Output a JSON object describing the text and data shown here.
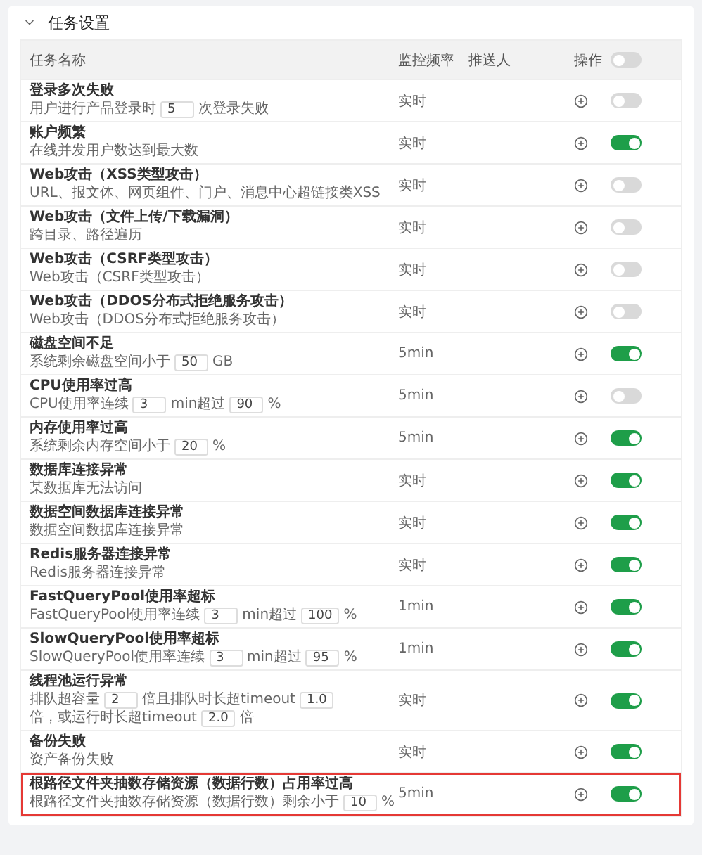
{
  "section": {
    "title": "任务设置",
    "expanded": true
  },
  "table": {
    "columns": [
      "任务名称",
      "监控频率",
      "推送人",
      "操作"
    ],
    "master_toggle": {
      "on": false
    },
    "rows": [
      {
        "name": "登录多次失败",
        "desc": [
          {
            "kind": "text",
            "text": "用户进行产品登录时"
          },
          {
            "kind": "input",
            "value": "5"
          },
          {
            "kind": "text",
            "text": "次登录失败"
          }
        ],
        "frequency": "实时",
        "on": false,
        "highlighted": false
      },
      {
        "name": "账户频繁",
        "desc": [
          {
            "kind": "text",
            "text": "在线并发用户数达到最大数"
          }
        ],
        "frequency": "实时",
        "on": true,
        "highlighted": false
      },
      {
        "name": "Web攻击（XSS类型攻击）",
        "desc": [
          {
            "kind": "text",
            "text": "URL、报文体、网页组件、门户、消息中心超链接类XSS"
          }
        ],
        "frequency": "实时",
        "on": false,
        "highlighted": false
      },
      {
        "name": "Web攻击（文件上传/下载漏洞）",
        "desc": [
          {
            "kind": "text",
            "text": "跨目录、路径遍历"
          }
        ],
        "frequency": "实时",
        "on": false,
        "highlighted": false
      },
      {
        "name": "Web攻击（CSRF类型攻击）",
        "desc": [
          {
            "kind": "text",
            "text": "Web攻击（CSRF类型攻击）"
          }
        ],
        "frequency": "实时",
        "on": false,
        "highlighted": false
      },
      {
        "name": "Web攻击（DDOS分布式拒绝服务攻击）",
        "desc": [
          {
            "kind": "text",
            "text": "Web攻击（DDOS分布式拒绝服务攻击）"
          }
        ],
        "frequency": "实时",
        "on": false,
        "highlighted": false
      },
      {
        "name": "磁盘空间不足",
        "desc": [
          {
            "kind": "text",
            "text": "系统剩余磁盘空间小于"
          },
          {
            "kind": "input",
            "value": "50"
          },
          {
            "kind": "text",
            "text": "GB"
          }
        ],
        "frequency": "5min",
        "on": true,
        "highlighted": false
      },
      {
        "name": "CPU使用率过高",
        "desc": [
          {
            "kind": "text",
            "text": "CPU使用率连续"
          },
          {
            "kind": "input",
            "value": "3"
          },
          {
            "kind": "text",
            "text": "min超过"
          },
          {
            "kind": "input",
            "value": "90"
          },
          {
            "kind": "text",
            "text": "%"
          }
        ],
        "frequency": "5min",
        "on": false,
        "highlighted": false
      },
      {
        "name": "内存使用率过高",
        "desc": [
          {
            "kind": "text",
            "text": "系统剩余内存空间小于"
          },
          {
            "kind": "input",
            "value": "20"
          },
          {
            "kind": "text",
            "text": "%"
          }
        ],
        "frequency": "5min",
        "on": true,
        "highlighted": false
      },
      {
        "name": "数据库连接异常",
        "desc": [
          {
            "kind": "text",
            "text": "某数据库无法访问"
          }
        ],
        "frequency": "实时",
        "on": true,
        "highlighted": false
      },
      {
        "name": "数据空间数据库连接异常",
        "desc": [
          {
            "kind": "text",
            "text": "数据空间数据库连接异常"
          }
        ],
        "frequency": "实时",
        "on": true,
        "highlighted": false
      },
      {
        "name": "Redis服务器连接异常",
        "desc": [
          {
            "kind": "text",
            "text": "Redis服务器连接异常"
          }
        ],
        "frequency": "实时",
        "on": true,
        "highlighted": false
      },
      {
        "name": "FastQueryPool使用率超标",
        "desc": [
          {
            "kind": "text",
            "text": "FastQueryPool使用率连续"
          },
          {
            "kind": "input",
            "value": "3"
          },
          {
            "kind": "text",
            "text": "min超过"
          },
          {
            "kind": "input",
            "value": "100"
          },
          {
            "kind": "text",
            "text": "%"
          }
        ],
        "frequency": "1min",
        "on": true,
        "highlighted": false
      },
      {
        "name": "SlowQueryPool使用率超标",
        "desc": [
          {
            "kind": "text",
            "text": "SlowQueryPool使用率连续"
          },
          {
            "kind": "input",
            "value": "3"
          },
          {
            "kind": "text",
            "text": "min超过"
          },
          {
            "kind": "input",
            "value": "95"
          },
          {
            "kind": "text",
            "text": "%"
          }
        ],
        "frequency": "1min",
        "on": true,
        "highlighted": false
      },
      {
        "name": "线程池运行异常",
        "desc": [
          {
            "kind": "text",
            "text": "排队超容量"
          },
          {
            "kind": "input",
            "value": "2"
          },
          {
            "kind": "text",
            "text": "倍且排队时长超timeout"
          },
          {
            "kind": "input",
            "value": "1.0"
          },
          {
            "kind": "text",
            "text": "倍，或运行时长超timeout"
          },
          {
            "kind": "input",
            "value": "2.0"
          },
          {
            "kind": "text",
            "text": "倍"
          }
        ],
        "frequency": "实时",
        "on": true,
        "highlighted": false
      },
      {
        "name": "备份失败",
        "desc": [
          {
            "kind": "text",
            "text": "资产备份失败"
          }
        ],
        "frequency": "实时",
        "on": true,
        "highlighted": false
      },
      {
        "name": "根路径文件夹抽数存储资源（数据行数）占用率过高",
        "desc": [
          {
            "kind": "text",
            "text": "根路径文件夹抽数存储资源（数据行数）剩余小于"
          },
          {
            "kind": "input",
            "value": "10"
          },
          {
            "kind": "text",
            "text": "%"
          }
        ],
        "frequency": "5min",
        "on": true,
        "highlighted": true
      }
    ]
  }
}
